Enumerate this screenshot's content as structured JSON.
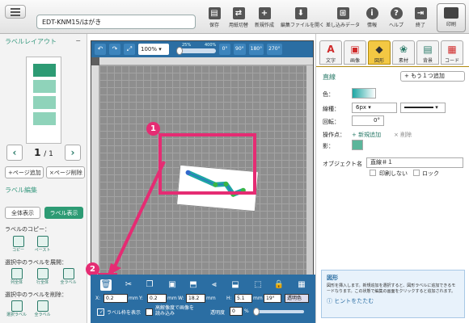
{
  "app": {
    "title": "EDT-KNM15/はがき"
  },
  "toolbar": {
    "buttons": [
      {
        "label": "保存",
        "icon": "save-icon"
      },
      {
        "label": "用紙切替",
        "icon": "paper-switch-icon"
      },
      {
        "label": "新規作成",
        "icon": "new-doc-icon"
      },
      {
        "label": "編集ファイルを開く",
        "icon": "open-file-icon"
      },
      {
        "label": "差し込みデータ",
        "icon": "merge-data-icon"
      },
      {
        "label": "情報",
        "icon": "info-icon"
      },
      {
        "label": "ヘルプ",
        "icon": "help-icon"
      },
      {
        "label": "終了",
        "icon": "exit-icon"
      }
    ],
    "print": "印刷"
  },
  "left": {
    "layout_title": "ラベルレイアウト",
    "collapse": "−",
    "page_current": "1",
    "page_total": "/ 1",
    "page_add": "+ページ追加",
    "page_delete": "×ページ削除",
    "label_edit_title": "ラベル編集",
    "show_all": "全体表示",
    "show_label": "ラベル表示",
    "copy_title": "ラベルのコピー：",
    "copy": "コピー",
    "paste": "ペースト",
    "expand_title": "選択中のラベルを展開：",
    "expand": [
      "列全体",
      "行全体",
      "全ラベル"
    ],
    "delete_title": "選択中のラベルを削除：",
    "delete": [
      "選択ラベル",
      "全ラベル"
    ],
    "colors": {
      "accent": "#3a9a80",
      "dark": "#2d9b74",
      "light": "#8fd3ba"
    }
  },
  "canvas": {
    "zoom": "100%",
    "zoom_min": "25%",
    "zoom_max": "400%",
    "rotate_buttons": [
      "0°",
      "90°",
      "180°",
      "270°"
    ],
    "background": "#8e8e8e",
    "accent": "#2b6ea3"
  },
  "bottom": {
    "x_label": "X:",
    "x_value": "0.2",
    "x_unit": "mm",
    "y_label": "Y:",
    "y_value": "0.2",
    "y_unit": "mm",
    "w_label": "W:",
    "w_value": "18.2",
    "w_unit": "mm",
    "h_label": "H:",
    "h_value": "5.1",
    "h_unit": "mm",
    "rotation": "19°",
    "transparent_color": "透明色",
    "show_frame": "ラベル枠を表示",
    "hires_image": "高解像度で画像を読み込み",
    "opacity_label": "透明度",
    "opacity_value": "0",
    "opacity_unit": "%"
  },
  "right": {
    "tabs": [
      {
        "label": "文字",
        "icon_char": "A",
        "color": "#d02a2a"
      },
      {
        "label": "画像",
        "icon_char": "▣",
        "color": "#d02a2a"
      },
      {
        "label": "図形",
        "icon_char": "◆",
        "color": "#333"
      },
      {
        "label": "素材",
        "icon_char": "❀",
        "color": "#2a7a68"
      },
      {
        "label": "背景",
        "icon_char": "▤",
        "color": "#2a7a68"
      },
      {
        "label": "コード",
        "icon_char": "▦",
        "color": "#d02a2a"
      }
    ],
    "section": "直線",
    "add_another": "+ もう１つ追加",
    "color_label": "色：",
    "line_width_label": "線種：",
    "line_width_value": "6px",
    "rotation_label": "回転：",
    "rotation_value": "0°",
    "points_label": "操作点：",
    "add_new": "+ 新規追加",
    "delete": "× 削除",
    "shadow_label": "影：",
    "object_name_label": "オブジェクト名",
    "object_name_value": "直線＃１",
    "no_print": "印刷しない",
    "lock": "ロック",
    "help_title": "図形",
    "help_text": "図形を挿入します。新規追加を選択すると、図形ラベルに追加できるモードなります。この状態で編集の画面をクリックすると追加されます。",
    "hide_hint": "ヒントをたたむ"
  },
  "annotations": {
    "marker1": "1",
    "marker2": "2"
  }
}
